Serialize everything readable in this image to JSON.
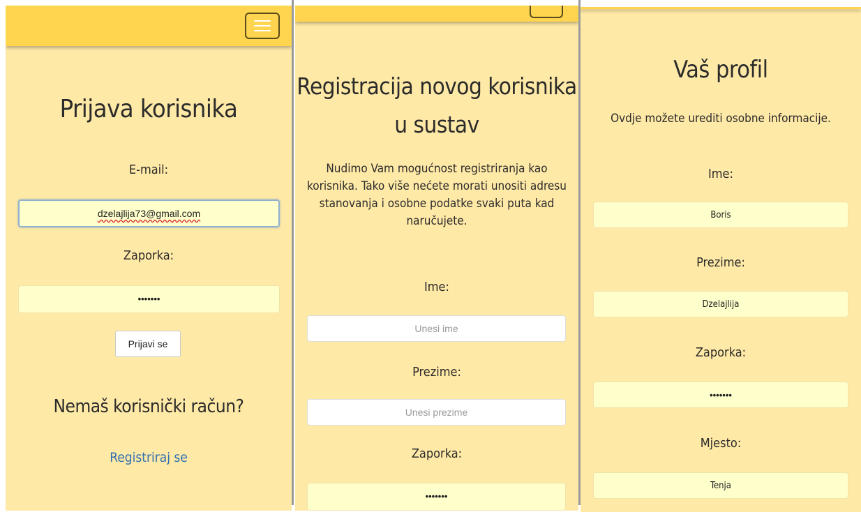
{
  "login": {
    "title": "Prijava korisnika",
    "email_label": "E-mail:",
    "email_value": "dzelajlija73@gmail.com",
    "password_label": "Zaporka:",
    "password_value": "•••••••",
    "submit_label": "Prijavi se",
    "no_account_text": "Nemaš korisnički račun?",
    "register_link": "Registriraj se"
  },
  "register": {
    "title_line1": "Registracija novog korisnika",
    "title_line2": "u sustav",
    "description_line1": "Nudimo Vam mogućnost registriranja kao",
    "description_line2": "korisnika. Tako više nećete morati unositi adresu",
    "description_line3": "stanovanja i osobne podatke svaki puta kad",
    "description_line4": "naručujete.",
    "first_name_label": "Ime:",
    "first_name_placeholder": "Unesi ime",
    "last_name_label": "Prezime:",
    "last_name_placeholder": "Unesi prezime",
    "password_label": "Zaporka:",
    "password_value": "•••••••"
  },
  "profile": {
    "title": "Vaš profil",
    "subtitle": "Ovdje možete urediti osobne informacije.",
    "first_name_label": "Ime:",
    "first_name_value": "Boris",
    "last_name_label": "Prezime:",
    "last_name_value": "Dzelajlija",
    "password_label": "Zaporka:",
    "password_value": "•••••••",
    "city_label": "Mjesto:",
    "city_value": "Tenja"
  },
  "colors": {
    "header": "#ffd54f",
    "background": "#ffe9a6",
    "input": "#ffffcc",
    "link": "#2f6fb0"
  }
}
